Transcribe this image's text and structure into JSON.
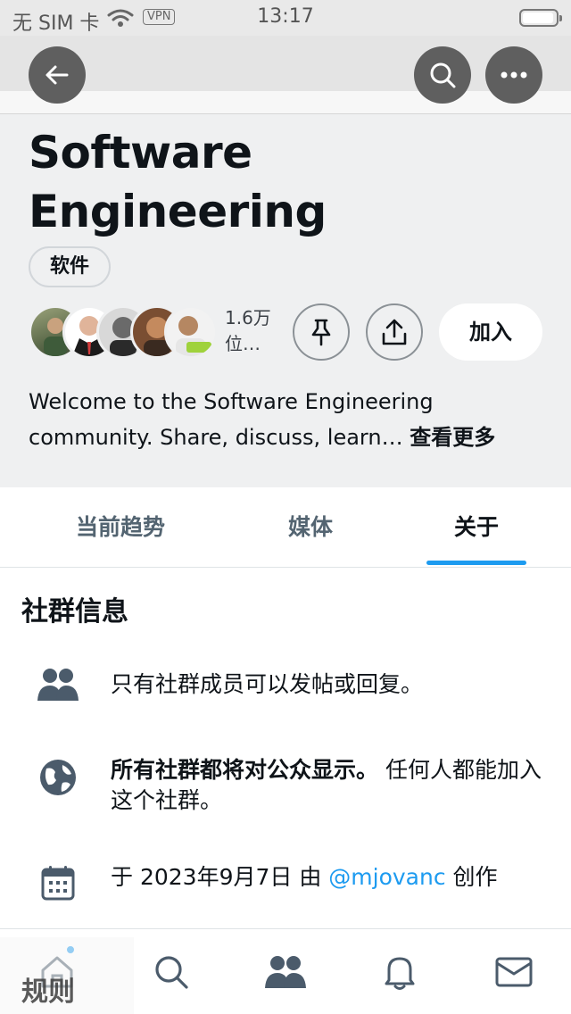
{
  "status_bar": {
    "carrier": "无 SIM 卡",
    "vpn": "VPN",
    "time": "13:17"
  },
  "community": {
    "title": "Software Engineering",
    "tag": "软件",
    "member_count": "1.6万位…",
    "join_label": "加入",
    "description": "Welcome to the Software Engineering community. Share, discuss, learn…",
    "see_more": "查看更多"
  },
  "tabs": [
    {
      "label": "当前趋势",
      "selected": false
    },
    {
      "label": "媒体",
      "selected": false
    },
    {
      "label": "关于",
      "selected": true
    }
  ],
  "about": {
    "section_title": "社群信息",
    "members_only": "只有社群成员可以发帖或回复。",
    "visibility_bold": "所有社群都将对公众显示。",
    "visibility_rest": " 任何人都能加入这个社群。",
    "created_prefix": "于 2023年9月7日 由 ",
    "created_by": "@mjovanc",
    "created_suffix": " 创作"
  },
  "bottom_overlay": {
    "label": "规则"
  },
  "colors": {
    "accent": "#1d9bf0",
    "header_bg": "#eff0f1",
    "text": "#0f1419",
    "muted": "#536471"
  },
  "icons": {
    "back": "arrow-left-icon",
    "search": "search-icon",
    "more": "more-icon",
    "pin": "pin-icon",
    "share": "share-icon",
    "members": "people-icon",
    "globe": "globe-icon",
    "calendar": "calendar-icon"
  }
}
